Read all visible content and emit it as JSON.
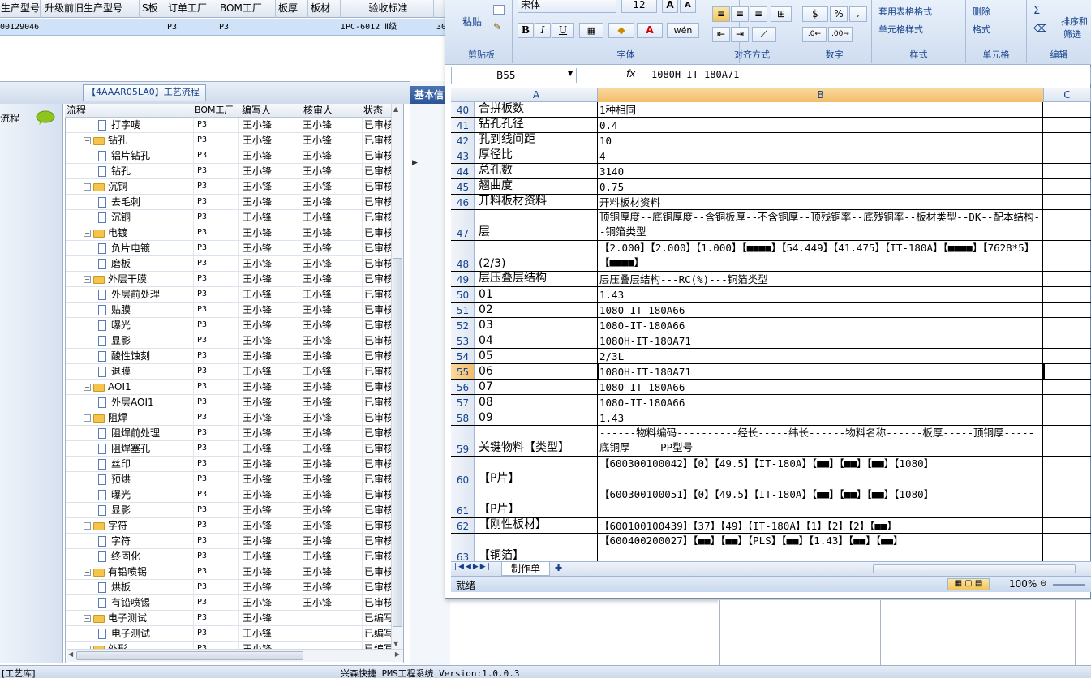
{
  "top_grid": {
    "headers": [
      "生产型号",
      "升级前旧生产型号",
      "S板",
      "订单工厂",
      "BOM工厂",
      "板厚",
      "板材",
      "验收标准"
    ],
    "row": {
      "model": "00129046",
      "factory": "P3",
      "bom_factory": "P3",
      "standard": "IPC-6012 Ⅱ级",
      "extra": "30"
    }
  },
  "process_tab": "【4AAAR05LA0】工艺流程",
  "left_panel": {
    "label": "流程"
  },
  "tree": {
    "headers": [
      "流程",
      "BOM工厂",
      "编写人",
      "核审人",
      "状态"
    ],
    "rows": [
      {
        "name": "打字唛",
        "type": "leaf",
        "factory": "P3",
        "writer": "王小锋",
        "reviewer": "王小锋",
        "status": "已审核"
      },
      {
        "name": "钻孔",
        "type": "folder",
        "factory": "P3",
        "writer": "王小锋",
        "reviewer": "王小锋",
        "status": "已审核"
      },
      {
        "name": "铝片钻孔",
        "type": "leaf",
        "factory": "P3",
        "writer": "王小锋",
        "reviewer": "王小锋",
        "status": "已审核"
      },
      {
        "name": "钻孔",
        "type": "leaf",
        "factory": "P3",
        "writer": "王小锋",
        "reviewer": "王小锋",
        "status": "已审核"
      },
      {
        "name": "沉铜",
        "type": "folder",
        "factory": "P3",
        "writer": "王小锋",
        "reviewer": "王小锋",
        "status": "已审核"
      },
      {
        "name": "去毛刺",
        "type": "leaf",
        "factory": "P3",
        "writer": "王小锋",
        "reviewer": "王小锋",
        "status": "已审核"
      },
      {
        "name": "沉铜",
        "type": "leaf",
        "factory": "P3",
        "writer": "王小锋",
        "reviewer": "王小锋",
        "status": "已审核"
      },
      {
        "name": "电镀",
        "type": "folder",
        "factory": "P3",
        "writer": "王小锋",
        "reviewer": "王小锋",
        "status": "已审核"
      },
      {
        "name": "负片电镀",
        "type": "leaf",
        "factory": "P3",
        "writer": "王小锋",
        "reviewer": "王小锋",
        "status": "已审核"
      },
      {
        "name": "磨板",
        "type": "leaf",
        "factory": "P3",
        "writer": "王小锋",
        "reviewer": "王小锋",
        "status": "已审核"
      },
      {
        "name": "外层干膜",
        "type": "folder",
        "factory": "P3",
        "writer": "王小锋",
        "reviewer": "王小锋",
        "status": "已审核"
      },
      {
        "name": "外层前处理",
        "type": "leaf",
        "factory": "P3",
        "writer": "王小锋",
        "reviewer": "王小锋",
        "status": "已审核"
      },
      {
        "name": "贴膜",
        "type": "leaf",
        "factory": "P3",
        "writer": "王小锋",
        "reviewer": "王小锋",
        "status": "已审核"
      },
      {
        "name": "曝光",
        "type": "leaf",
        "factory": "P3",
        "writer": "王小锋",
        "reviewer": "王小锋",
        "status": "已审核"
      },
      {
        "name": "显影",
        "type": "leaf",
        "factory": "P3",
        "writer": "王小锋",
        "reviewer": "王小锋",
        "status": "已审核"
      },
      {
        "name": "酸性蚀刻",
        "type": "leaf",
        "factory": "P3",
        "writer": "王小锋",
        "reviewer": "王小锋",
        "status": "已审核"
      },
      {
        "name": "退膜",
        "type": "leaf",
        "factory": "P3",
        "writer": "王小锋",
        "reviewer": "王小锋",
        "status": "已审核"
      },
      {
        "name": "AOI1",
        "type": "folder",
        "factory": "P3",
        "writer": "王小锋",
        "reviewer": "王小锋",
        "status": "已审核"
      },
      {
        "name": "外层AOI1",
        "type": "leaf",
        "factory": "P3",
        "writer": "王小锋",
        "reviewer": "王小锋",
        "status": "已审核"
      },
      {
        "name": "阻焊",
        "type": "folder",
        "factory": "P3",
        "writer": "王小锋",
        "reviewer": "王小锋",
        "status": "已审核"
      },
      {
        "name": "阻焊前处理",
        "type": "leaf",
        "factory": "P3",
        "writer": "王小锋",
        "reviewer": "王小锋",
        "status": "已审核"
      },
      {
        "name": "阻焊塞孔",
        "type": "leaf",
        "factory": "P3",
        "writer": "王小锋",
        "reviewer": "王小锋",
        "status": "已审核"
      },
      {
        "name": "丝印",
        "type": "leaf",
        "factory": "P3",
        "writer": "王小锋",
        "reviewer": "王小锋",
        "status": "已审核"
      },
      {
        "name": "预烘",
        "type": "leaf",
        "factory": "P3",
        "writer": "王小锋",
        "reviewer": "王小锋",
        "status": "已审核"
      },
      {
        "name": "曝光",
        "type": "leaf",
        "factory": "P3",
        "writer": "王小锋",
        "reviewer": "王小锋",
        "status": "已审核"
      },
      {
        "name": "显影",
        "type": "leaf",
        "factory": "P3",
        "writer": "王小锋",
        "reviewer": "王小锋",
        "status": "已审核"
      },
      {
        "name": "字符",
        "type": "folder",
        "factory": "P3",
        "writer": "王小锋",
        "reviewer": "王小锋",
        "status": "已审核"
      },
      {
        "name": "字符",
        "type": "leaf",
        "factory": "P3",
        "writer": "王小锋",
        "reviewer": "王小锋",
        "status": "已审核"
      },
      {
        "name": "终固化",
        "type": "leaf",
        "factory": "P3",
        "writer": "王小锋",
        "reviewer": "王小锋",
        "status": "已审核"
      },
      {
        "name": "有铅喷锡",
        "type": "folder",
        "factory": "P3",
        "writer": "王小锋",
        "reviewer": "王小锋",
        "status": "已审核"
      },
      {
        "name": "烘板",
        "type": "leaf",
        "factory": "P3",
        "writer": "王小锋",
        "reviewer": "王小锋",
        "status": "已审核"
      },
      {
        "name": "有铅喷锡",
        "type": "leaf",
        "factory": "P3",
        "writer": "王小锋",
        "reviewer": "王小锋",
        "status": "已审核"
      },
      {
        "name": "电子测试",
        "type": "folder",
        "factory": "P3",
        "writer": "王小锋",
        "reviewer": "",
        "status": "已编写"
      },
      {
        "name": "电子测试",
        "type": "leaf",
        "factory": "P3",
        "writer": "王小锋",
        "reviewer": "",
        "status": "已编写"
      },
      {
        "name": "外形",
        "type": "folder",
        "factory": "P3",
        "writer": "王小锋",
        "reviewer": "",
        "status": "已编写"
      }
    ]
  },
  "mid_panel": {
    "tab": "基本信"
  },
  "excel": {
    "ribbon": {
      "font_name": "宋体",
      "font_size": "12",
      "paste": "粘贴",
      "groups": [
        "剪贴板",
        "字体",
        "对齐方式",
        "数字",
        "样式",
        "单元格",
        "编辑"
      ],
      "table_style": "套用表格格式",
      "cell_style": "单元格样式",
      "delete": "删除",
      "format": "格式",
      "sort_filter": [
        "排序和",
        "筛选"
      ]
    },
    "name_box": "B55",
    "formula": "1080H-IT-180A71",
    "columns": [
      "A",
      "B",
      "C"
    ],
    "rows": [
      {
        "num": "40",
        "a": "合拼板数",
        "b": "1种相同"
      },
      {
        "num": "41",
        "a": "钻孔孔径",
        "b": "0.4"
      },
      {
        "num": "42",
        "a": "孔到线间距",
        "b": "10"
      },
      {
        "num": "43",
        "a": "厚径比",
        "b": "4"
      },
      {
        "num": "44",
        "a": "总孔数",
        "b": "3140"
      },
      {
        "num": "45",
        "a": "翘曲度",
        "b": "0.75"
      },
      {
        "num": "46",
        "a": "开料板材资料",
        "b": "开料板材资料"
      },
      {
        "num": "47",
        "a": "层",
        "b": "顶铜厚度--底铜厚度--含铜板厚--不含铜厚--顶残铜率--底残铜率--板材类型--DK--配本结构--铜箔类型"
      },
      {
        "num": "48",
        "a": "(2/3)",
        "b": "【2.000】【2.000】【1.000】【■■■■】【54.449】【41.475】【IT-180A】【■■■■】【7628*5】【■■■■】"
      },
      {
        "num": "49",
        "a": "层压叠层结构",
        "b": "层压叠层结构---RC(%)---铜箔类型"
      },
      {
        "num": "50",
        "a": "01",
        "b": "1.43"
      },
      {
        "num": "51",
        "a": "02",
        "b": "1080-IT-180A66"
      },
      {
        "num": "52",
        "a": "03",
        "b": "1080-IT-180A66"
      },
      {
        "num": "53",
        "a": "04",
        "b": "1080H-IT-180A71"
      },
      {
        "num": "54",
        "a": "05",
        "b": "2/3L"
      },
      {
        "num": "55",
        "a": "06",
        "b": "1080H-IT-180A71"
      },
      {
        "num": "56",
        "a": "07",
        "b": "1080-IT-180A66"
      },
      {
        "num": "57",
        "a": "08",
        "b": "1080-IT-180A66"
      },
      {
        "num": "58",
        "a": "09",
        "b": "1.43"
      },
      {
        "num": "59",
        "a": "关键物料【类型】",
        "b": "------物料编码----------经长-----纬长------物料名称------板厚-----顶铜厚-----底铜厚-----PP型号"
      },
      {
        "num": "60",
        "a": "【P片】",
        "b": "【600300100042】【0】【49.5】【IT-180A】【■■】【■■】【■■】【1080】"
      },
      {
        "num": "61",
        "a": "【P片】",
        "b": "【600300100051】【0】【49.5】【IT-180A】【■■】【■■】【■■】【1080】"
      },
      {
        "num": "62",
        "a": "【刚性板材】",
        "b": "【600100100439】【37】【49】【IT-180A】【1】【2】【2】【■■】"
      },
      {
        "num": "63",
        "a": "【铜箔】",
        "b": "【600400200027】【■■】【■■】【PLS】【■■】【1.43】【■■】【■■】"
      }
    ],
    "sheet_tab": "制作单",
    "status": "就绪",
    "zoom": "100%"
  },
  "bottom_bar": {
    "left": "[工艺库]",
    "center": "兴森快捷 PMS工程系统 Version:1.0.0.3"
  }
}
